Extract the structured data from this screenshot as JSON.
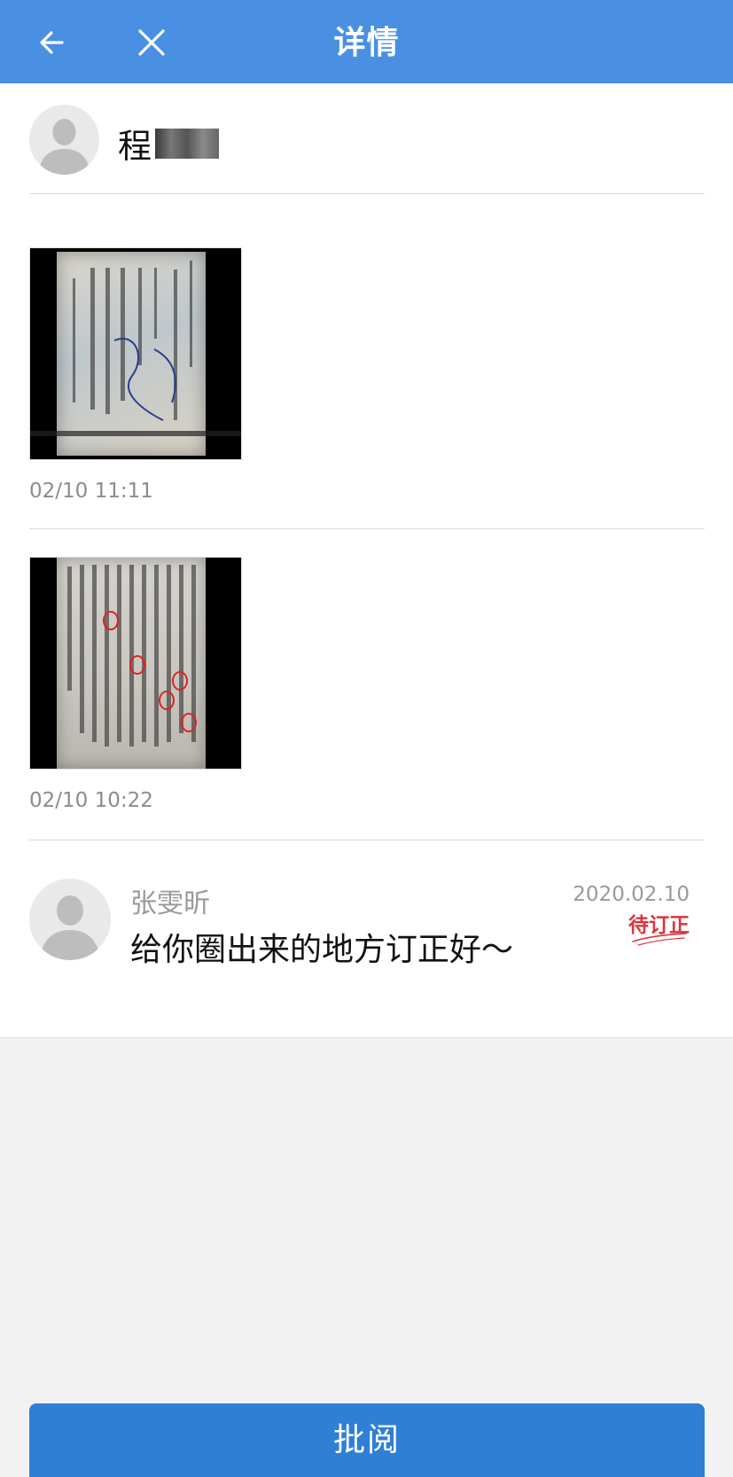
{
  "header": {
    "title": "详情",
    "back_icon": "arrow-left-icon",
    "close_icon": "close-icon",
    "bg_color": "#4a90e2"
  },
  "student": {
    "name": "程"
  },
  "submissions": [
    {
      "time": "02/10 11:11"
    },
    {
      "time": "02/10 10:22"
    }
  ],
  "comment": {
    "teacher_name": "张雯昕",
    "text": "给你圈出来的地方订正好～",
    "date": "2020.02.10",
    "status": "待订正",
    "status_color": "#d9363e"
  },
  "footer": {
    "review_label": "批阅",
    "button_color": "#2f7fd6"
  }
}
